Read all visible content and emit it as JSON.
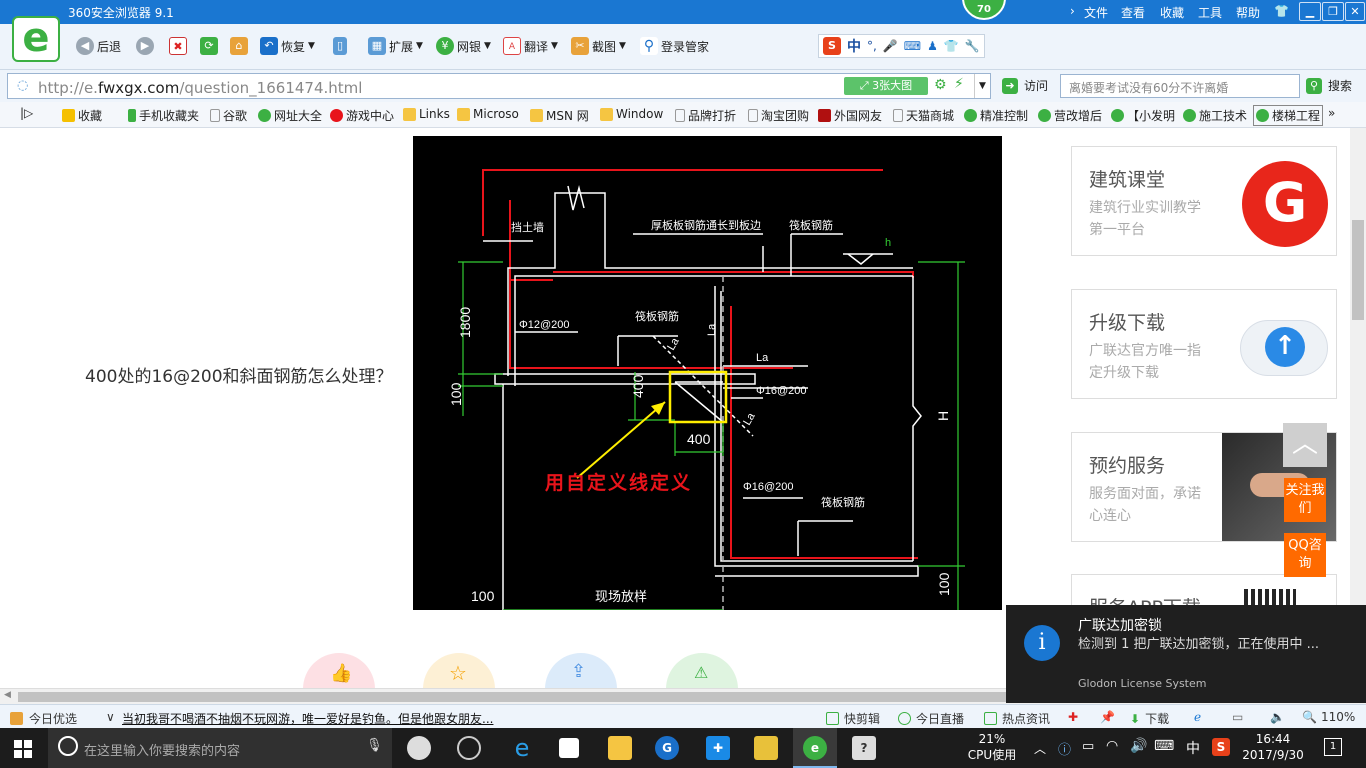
{
  "title_bar": {
    "title": "360安全浏览器 9.1",
    "score": "70",
    "menu": [
      "文件",
      "查看",
      "收藏",
      "工具",
      "帮助"
    ]
  },
  "toolbar": {
    "back": "后退",
    "restore": "恢复",
    "expand": "扩展",
    "bank": "网银",
    "translate": "翻译",
    "screenshot": "截图",
    "login": "登录管家",
    "ime_label": "中"
  },
  "address_bar": {
    "url_prefix": "http://e.",
    "url_domain": "fwxgx.com",
    "url_path": "/question_1661474.html",
    "image_button": "3张大图",
    "visit": "访问",
    "search_placeholder": "离婚要考试没有60分不许离婚",
    "search_button": "搜索"
  },
  "favorites": [
    "收藏",
    "手机收藏夹",
    "谷歌",
    "网址大全",
    "游戏中心",
    "Links",
    "Microso",
    "MSN 网",
    "Window",
    "品牌打折",
    "淘宝团购",
    "外国网友",
    "天猫商城",
    "精准控制",
    "营改增后",
    "【小发明",
    "施工技术",
    "楼梯工程"
  ],
  "main": {
    "question": "400处的16@200和斜面钢筋怎么处理？",
    "drawing": {
      "annotation": "用自定义线定义",
      "labels": [
        "挡土墙",
        "厚板板钢筋通长到板边",
        "筏板钢筋",
        "h",
        "1800",
        "Φ12@200",
        "筏板钢筋",
        "La",
        "La",
        "La",
        "La",
        "Φ16@200",
        "400",
        "400",
        "100",
        "H",
        "Φ16@200",
        "筏板钢筋",
        "100",
        "现场放样",
        "100"
      ]
    }
  },
  "sidebar": {
    "cards": [
      {
        "title": "建筑课堂",
        "desc": "建筑行业实训教学第一平台"
      },
      {
        "title": "升级下载",
        "desc": "广联达官方唯一指定升级下载"
      },
      {
        "title": "预约服务",
        "desc": "服务面对面，承诺心连心"
      },
      {
        "title": "服务APP下载",
        "desc": ""
      }
    ],
    "follow": "关注我们",
    "qq": "QQ咨询"
  },
  "notification": {
    "title": "广联达加密锁",
    "body": "检测到 1 把广联达加密锁，正在使用中 ...",
    "source": "Glodon License System"
  },
  "status_bar": {
    "today": "今日优选",
    "news": "当初我哥不喝酒不抽烟不玩网游，唯一爱好是钓鱼。但是他跟女朋友...",
    "clip": "快剪辑",
    "live": "今日直播",
    "hot": "热点资讯",
    "download": "下载",
    "zoom": "110%"
  },
  "taskbar": {
    "search_placeholder": "在这里输入你要搜索的内容",
    "cpu_percent": "21%",
    "cpu_label": "CPU使用",
    "ime": "中",
    "time": "16:44",
    "date": "2017/9/30",
    "notif_count": "1"
  },
  "colors": {
    "title_blue": "#1a77d2",
    "brand_green": "#3cb043",
    "accent_orange": "#ff6a00",
    "cad_red": "#e8141b",
    "cad_green": "#33cc33",
    "cad_yellow": "#ffee00"
  }
}
